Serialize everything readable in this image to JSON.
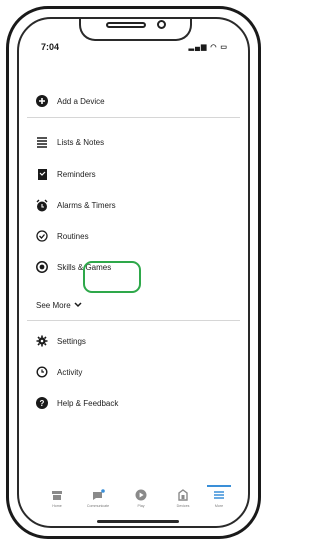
{
  "status": {
    "time": "7:04"
  },
  "menu": {
    "add_device": "Add a Device",
    "lists_notes": "Lists & Notes",
    "reminders": "Reminders",
    "alarms_timers": "Alarms & Timers",
    "routines": "Routines",
    "skills_games": "Skills & Games",
    "see_more": "See More",
    "settings": "Settings",
    "activity": "Activity",
    "help_feedback": "Help & Feedback"
  },
  "tabs": [
    {
      "label": "Home",
      "icon": "home-icon"
    },
    {
      "label": "Communicate",
      "icon": "chat-bubble-icon"
    },
    {
      "label": "Play",
      "icon": "play-icon"
    },
    {
      "label": "Devices",
      "icon": "devices-icon"
    },
    {
      "label": "More",
      "icon": "menu-icon"
    }
  ],
  "colors": {
    "highlight": "#2ea84a",
    "active_tab": "#3a8fd8"
  }
}
